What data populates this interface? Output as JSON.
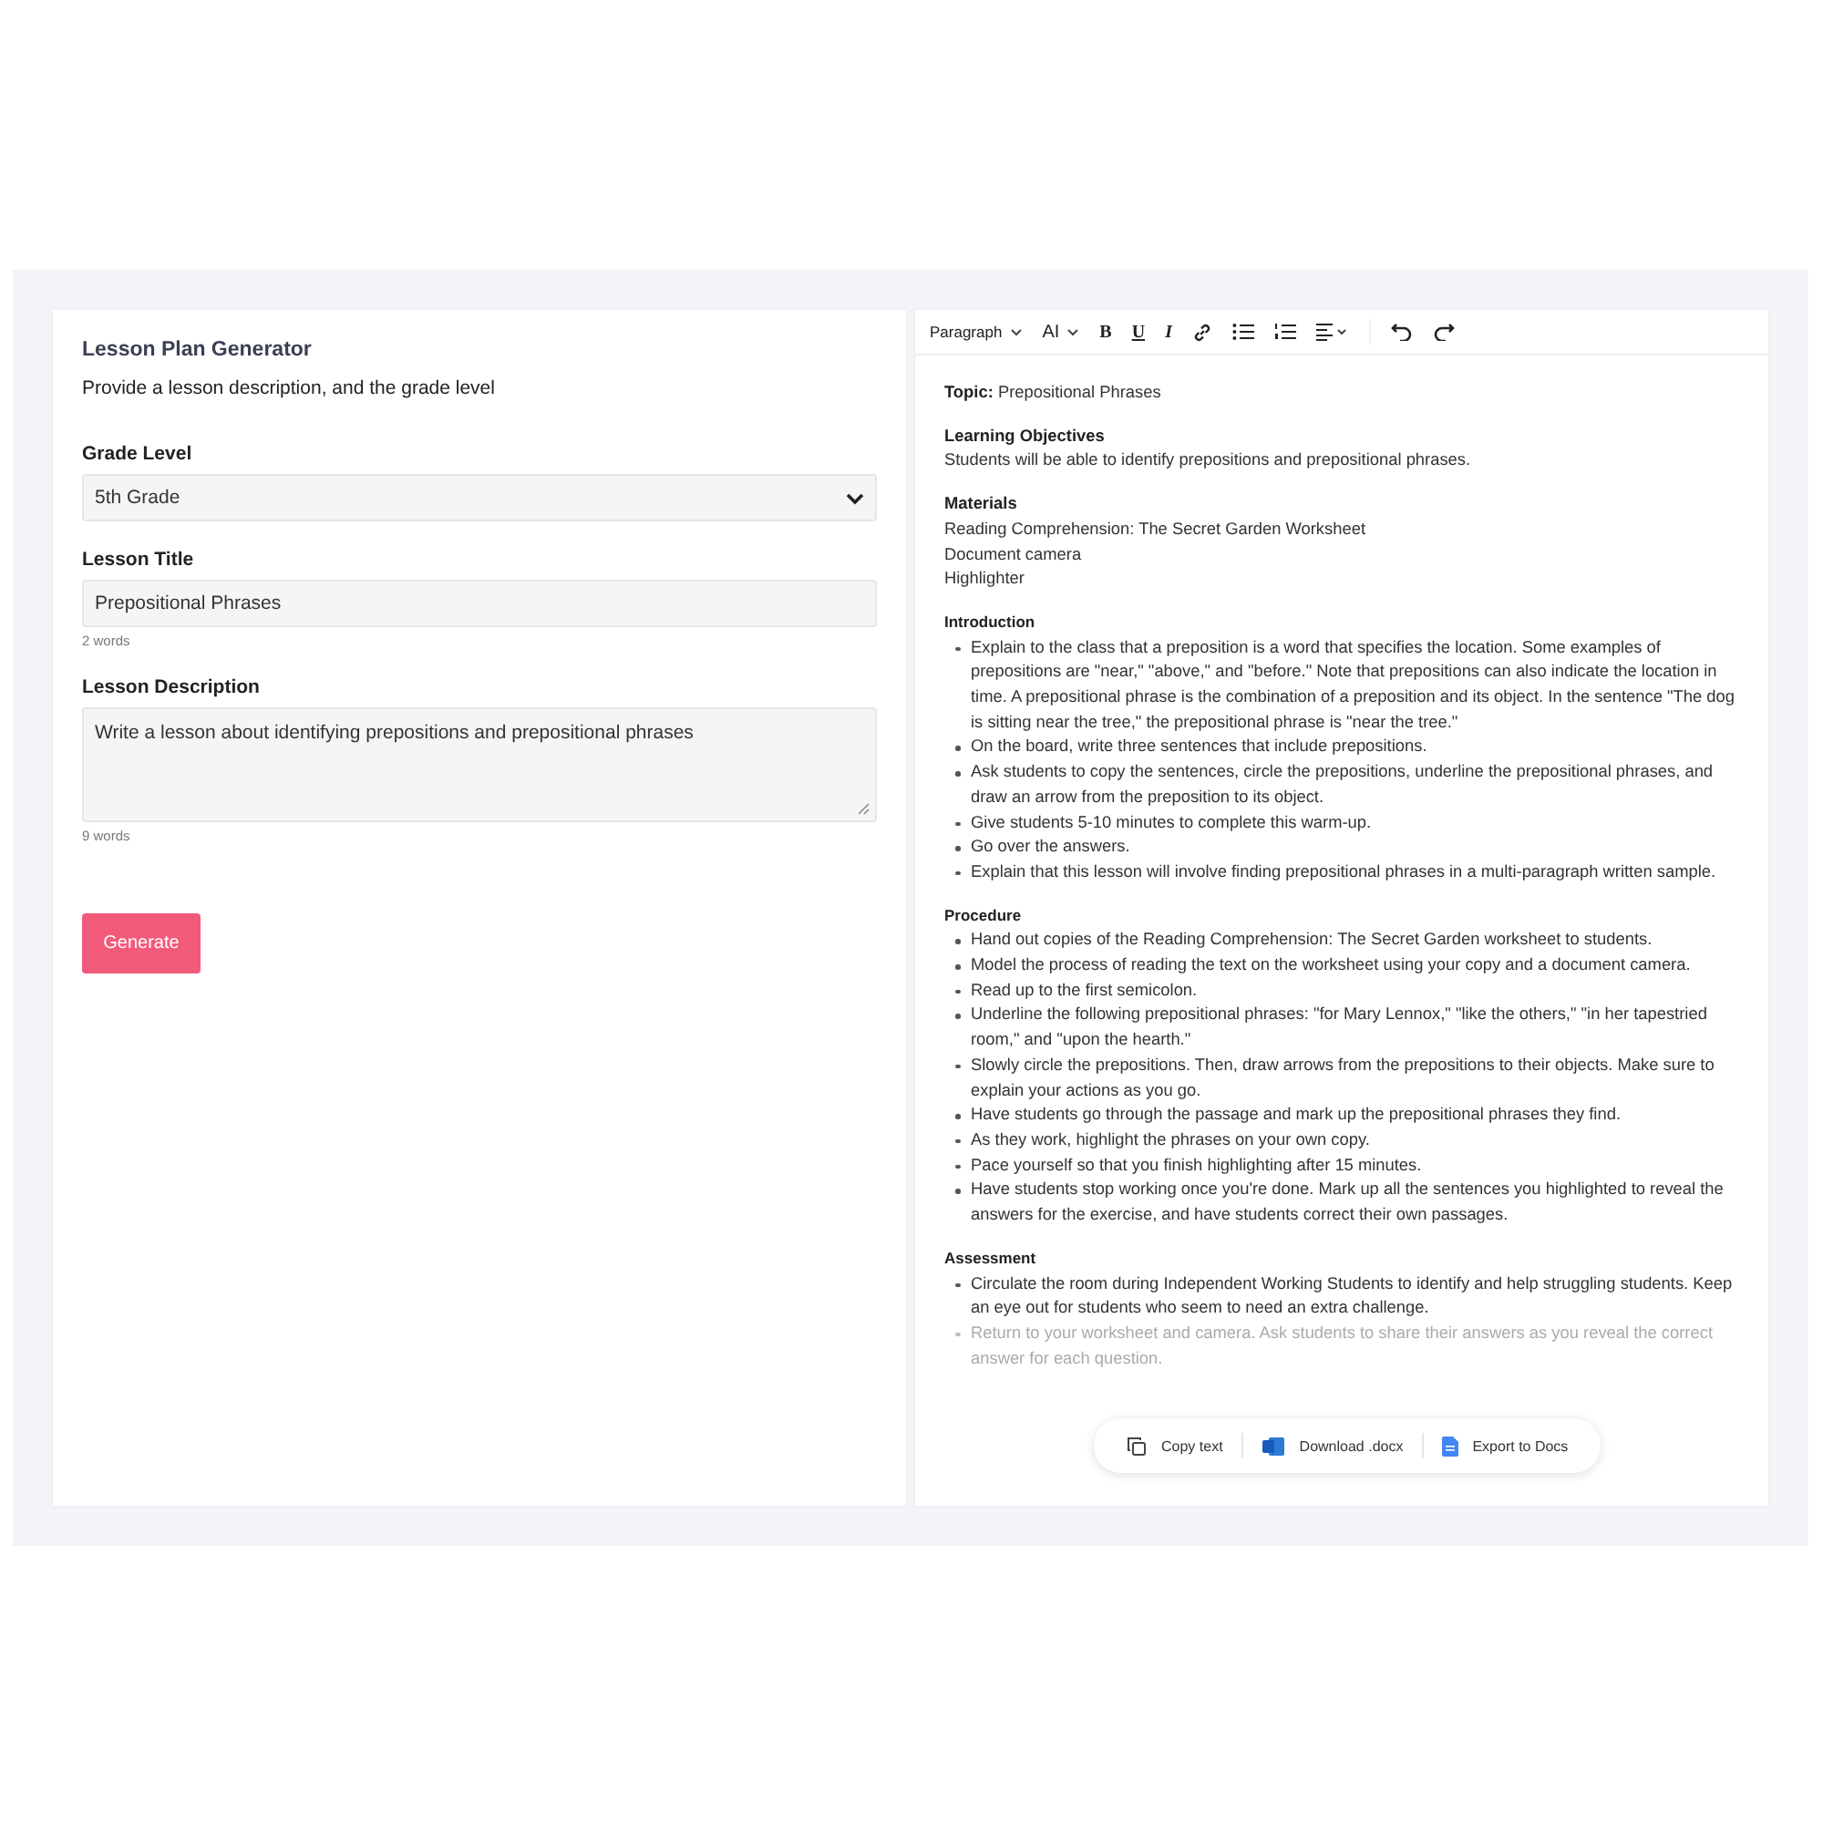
{
  "form": {
    "title": "Lesson Plan Generator",
    "subtitle": "Provide a lesson description, and the grade level",
    "fields": [
      {
        "kind": "select",
        "label": "Grade Level",
        "value": "5th Grade"
      },
      {
        "kind": "text",
        "label": "Lesson Title",
        "value": "Prepositional Phrases",
        "count": "2 words"
      },
      {
        "kind": "textarea",
        "label": "Lesson Description",
        "value": "Write a lesson about identifying prepositions and prepositional phrases",
        "count": "9 words"
      }
    ],
    "button": "Generate"
  },
  "toolbar": {
    "block_style": "Paragraph",
    "font_size": "AI",
    "bold": "B",
    "underline": "U",
    "italic": "I"
  },
  "document": [
    {
      "kind": "topic",
      "label": "Topic:",
      "text": "Prepositional Phrases"
    },
    {
      "kind": "lines",
      "heading": "Learning Objectives",
      "lines": [
        "Students will be able to identify prepositions and prepositional phrases."
      ]
    },
    {
      "kind": "lines",
      "heading": "Materials",
      "lines": [
        "Reading Comprehension: The Secret Garden Worksheet",
        "Document camera",
        "Highlighter"
      ]
    },
    {
      "kind": "bullets",
      "heading": "Introduction",
      "items": [
        {
          "text": "Explain to the class that a preposition is a word that specifies the location. Some examples of prepositions are \"near,\" \"above,\" and \"before.\" Note that prepositions can also indicate the location in time. A prepositional phrase is the combination of a preposition and its object. In the sentence \"The dog is sitting near the tree,\" the prepositional phrase is \"near the tree.\"",
          "faded": false
        },
        {
          "text": "On the board, write three sentences that include prepositions.",
          "faded": false
        },
        {
          "text": "Ask students to copy the sentences, circle the prepositions, underline the prepositional phrases, and draw an arrow from the preposition to its object.",
          "faded": false
        },
        {
          "text": "Give students 5-10 minutes to complete this warm-up.",
          "faded": false
        },
        {
          "text": "Go over the answers.",
          "faded": false
        },
        {
          "text": "Explain that this lesson will involve finding prepositional phrases in a multi-paragraph written sample.",
          "faded": false
        }
      ]
    },
    {
      "kind": "bullets",
      "heading": "Procedure",
      "items": [
        {
          "text": "Hand out copies of the Reading Comprehension: The Secret Garden worksheet to students.",
          "faded": false
        },
        {
          "text": "Model the process of reading the text on the worksheet using your copy and a document camera.",
          "faded": false
        },
        {
          "text": "Read up to the first semicolon.",
          "faded": false
        },
        {
          "text": "Underline the following prepositional phrases: \"for Mary Lennox,\" \"like the others,\" \"in her tapestried room,\" and \"upon the hearth.\"",
          "faded": false
        },
        {
          "text": "Slowly circle the prepositions. Then, draw arrows from the prepositions to their objects. Make sure to explain your actions as you go.",
          "faded": false
        },
        {
          "text": "Have students go through the passage and mark up the prepositional phrases they find.",
          "faded": false
        },
        {
          "text": "As they work, highlight the phrases on your own copy.",
          "faded": false
        },
        {
          "text": "Pace yourself so that you finish highlighting after 15 minutes.",
          "faded": false
        },
        {
          "text": "Have students stop working once you're done. Mark up all the sentences you highlighted to reveal the answers for the exercise, and have students correct their own passages.",
          "faded": false
        }
      ]
    },
    {
      "kind": "bullets",
      "heading": "Assessment",
      "items": [
        {
          "text": "Circulate the room during Independent Working Students to identify and help struggling students. Keep an eye out for students who seem to need an extra challenge.",
          "faded": false
        },
        {
          "text": "Return to your worksheet and camera. Ask students to share their answers as you reveal the correct answer for each question.",
          "faded": true
        }
      ]
    }
  ],
  "actions": [
    {
      "kind": "copy",
      "label": "Copy text"
    },
    {
      "kind": "word",
      "label": "Download .docx"
    },
    {
      "kind": "docs",
      "label": "Export to Docs"
    }
  ]
}
